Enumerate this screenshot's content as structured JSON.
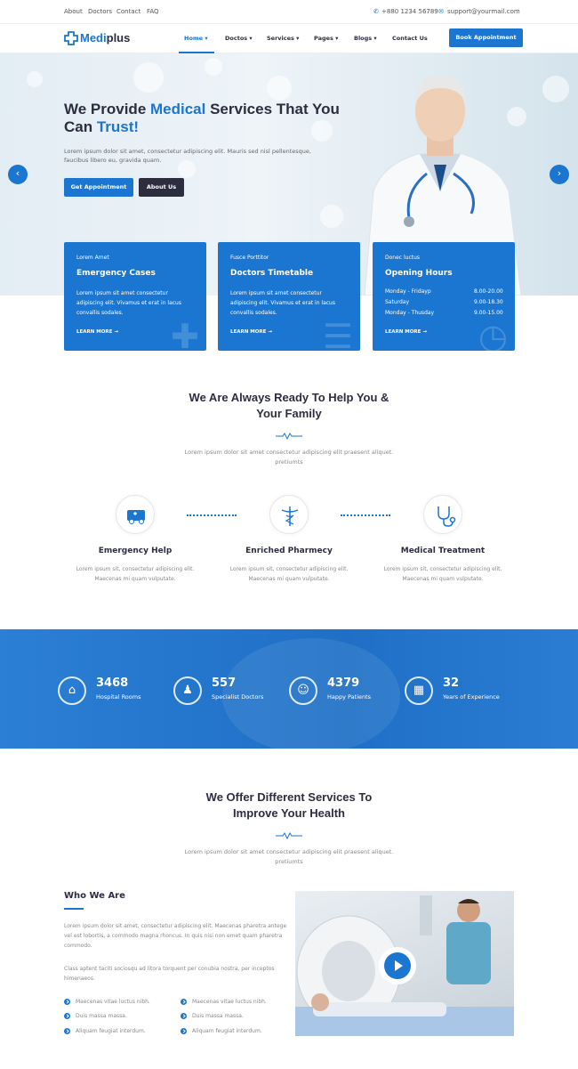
{
  "topbar": {
    "links": [
      "About",
      "Doctors",
      "Contact",
      "FAQ"
    ],
    "phone": "+880 1234 56789",
    "email": "support@yourmail.com"
  },
  "header": {
    "logo_part1": "Medi",
    "logo_part2": "plus",
    "nav": [
      "Home",
      "Doctos",
      "Services",
      "Pages",
      "Blogs",
      "Contact Us"
    ],
    "cta": "Book Appointment"
  },
  "hero": {
    "title_a": "We Provide ",
    "title_hl1": "Medical",
    "title_b": " Services That You Can ",
    "title_hl2": "Trust!",
    "text": "Lorem ipsum dolor sit amet, consectetur adipiscing elit. Mauris sed nisl pellentesque, faucibus libero eu, gravida quam.",
    "btn_primary": "Get Appointment",
    "btn_secondary": "About Us",
    "prev": "‹",
    "next": "›"
  },
  "cards": [
    {
      "sub": "Lorem Amet",
      "title": "Emergency Cases",
      "text": "Lorem ipsum sit amet consectetur adipiscing elit. Vivamus et erat in lacus convallis sodales.",
      "more": "LEARN MORE →"
    },
    {
      "sub": "Fusce Porttitor",
      "title": "Doctors Timetable",
      "text": "Lorem ipsum sit amet consectetur adipiscing elit. Vivamus et erat in lacus convallis sodales.",
      "more": "LEARN MORE →"
    },
    {
      "sub": "Donec luctus",
      "title": "Opening Hours",
      "more": "LEARN MORE →",
      "hours": [
        {
          "day": "Monday - Fridayp",
          "time": "8.00-20.00"
        },
        {
          "day": "Saturday",
          "time": "9.00-18.30"
        },
        {
          "day": "Monday - Thusday",
          "time": "9.00-15.00"
        }
      ]
    }
  ],
  "help": {
    "title1": "We Are Always Ready To Help You &",
    "title2": "Your Family",
    "sub1": "Lorem ipsum dolor sit amet consectetur adipiscing elit praesent aliquet.",
    "sub2": "pretiumts",
    "features": [
      {
        "name": "Emergency Help",
        "d1": "Lorem ipsum sit, consectetur adipiscing elit.",
        "d2": "Maecenas mi quam vulputate."
      },
      {
        "name": "Enriched Pharmecy",
        "d1": "Lorem ipsum sit, consectetur adipiscing elit.",
        "d2": "Maecenas mi quam vulputate."
      },
      {
        "name": "Medical Treatment",
        "d1": "Lorem ipsum sit, consectetur adipiscing elit.",
        "d2": "Maecenas mi quam vulputate."
      }
    ]
  },
  "counters": [
    {
      "num": "3468",
      "label": "Hospital Rooms",
      "icon": "⌂"
    },
    {
      "num": "557",
      "label": "Specialist Doctors",
      "icon": "♟"
    },
    {
      "num": "4379",
      "label": "Happy Patients",
      "icon": "☺"
    },
    {
      "num": "32",
      "label": "Years of Experience",
      "icon": "▦"
    }
  ],
  "services": {
    "title1": "We Offer Different Services To",
    "title2": "Improve Your Health",
    "sub1": "Lorem ipsum dolor sit amet consectetur adipiscing elit praesent aliquet.",
    "sub2": "pretiumts"
  },
  "who": {
    "title": "Who We Are",
    "p1": "Lorem ipsum dolor sit amet, consectetur adipiscing elit. Maecenas pharetra antege vel est lobortis, a commodo magna rhoncus. In quis nisi non emet quam pharetra commodo.",
    "p2": "Class aptent taciti sociosqu ad litora torquent per conubia nostra, per inceptos himenaeos.",
    "list": [
      "Maecenas vitae luctus nibh.",
      "Duis massa massa.",
      "Aliquam feugiat interdum.",
      "Maecenas vitae luctus nibh.",
      "Duis massa massa.",
      "Aliquam feugiat interdum."
    ]
  }
}
